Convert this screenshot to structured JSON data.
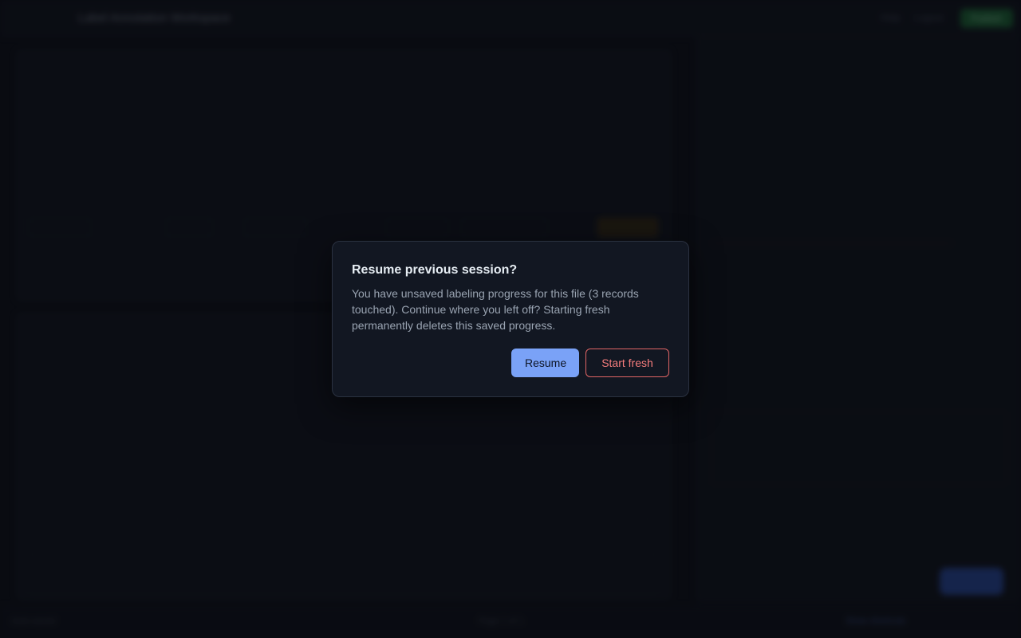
{
  "background": {
    "app_title": "Label Annotation Workspace",
    "top_links": [
      "Help",
      "Logout"
    ],
    "publish_label": "Publish",
    "footer_left": "Auto-saved",
    "footer_center": "Page 1 of 1",
    "footer_right": "Show shortcuts"
  },
  "dialog": {
    "title": "Resume previous session?",
    "body": "You have unsaved labeling progress for this file (3 records touched). Continue where you left off? Starting fresh permanently deletes this saved progress.",
    "resume_label": "Resume",
    "start_fresh_label": "Start fresh"
  },
  "colors": {
    "accent": "#7aa2f7",
    "danger": "#e06565",
    "dialog_bg": "#121722"
  }
}
